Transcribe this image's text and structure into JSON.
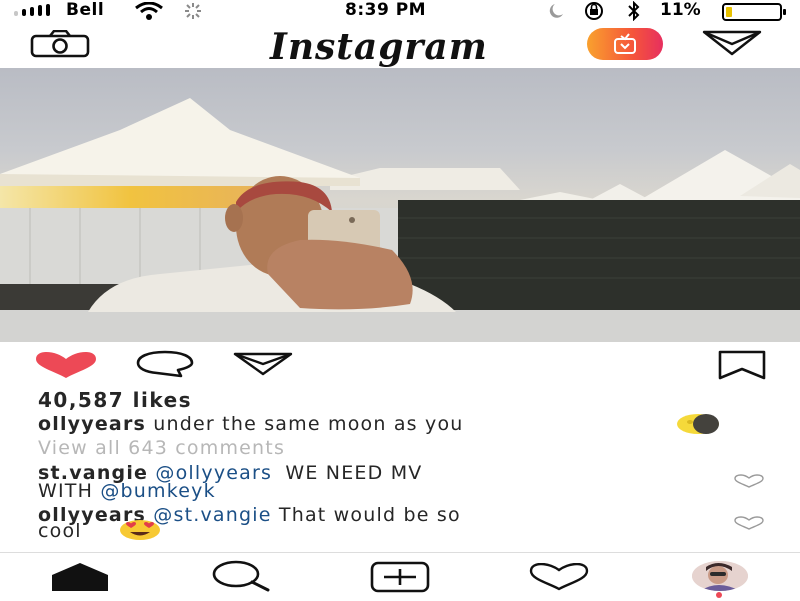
{
  "status_bar": {
    "carrier": "Bell",
    "time": "8:39 PM",
    "battery_percent": "11%",
    "battery_level": 0.11
  },
  "header": {
    "title": "Instagram",
    "icons": [
      "camera-icon",
      "igtv-icon",
      "direct-message-icon"
    ]
  },
  "post": {
    "actions": [
      "like-icon",
      "comment-icon",
      "share-icon",
      "bookmark-icon"
    ],
    "liked": true,
    "likes": "40,587 likes",
    "caption": {
      "username": "ollyyears",
      "text": "under the same moon as you",
      "emoji": "moon"
    },
    "view_comments": "View all 643 comments",
    "comments": [
      {
        "username": "st.vangie",
        "mention1": "@ollyyears",
        "text1": "WE NEED MV",
        "text2": "WITH",
        "mention2": "@bumkeyk"
      },
      {
        "username": "ollyyears",
        "mention1": "@st.vangie",
        "text1": "That would be so",
        "text2": "cool",
        "emoji": "heart-eyes"
      }
    ]
  },
  "tab_bar": {
    "items": [
      "home-icon",
      "search-icon",
      "new-post-icon",
      "activity-icon",
      "profile-avatar"
    ],
    "active": "home-icon"
  },
  "colors": {
    "like": "#ed4956",
    "link": "#1b4f86",
    "muted": "#b7b7b7",
    "igtv_gradient": [
      "#f9a12e",
      "#f5553a",
      "#e72f5f"
    ]
  }
}
